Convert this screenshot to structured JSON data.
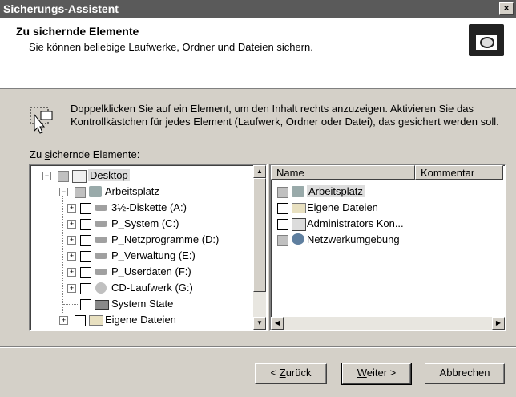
{
  "window": {
    "title": "Sicherungs-Assistent",
    "close_label": "×"
  },
  "header": {
    "title": "Zu sichernde Elemente",
    "subtitle": "Sie können beliebige Laufwerke, Ordner und Dateien sichern."
  },
  "info": {
    "text": "Doppelklicken Sie auf ein Element, um den Inhalt rechts anzuzeigen. Aktivieren Sie das Kontrollkästchen für jedes Element (Laufwerk, Ordner oder Datei), das gesichert werden soll."
  },
  "tree": {
    "label_pre": "Zu ",
    "label_key": "s",
    "label_post": "ichernde Elemente:",
    "items": [
      {
        "label": "Desktop",
        "icon": "desktop-icon"
      },
      {
        "label": "Arbeitsplatz",
        "icon": "computer-icon"
      },
      {
        "label": "3½-Diskette (A:)",
        "icon": "floppy-drive-icon"
      },
      {
        "label": "P_System (C:)",
        "icon": "drive-icon"
      },
      {
        "label": "P_Netzprogramme (D:)",
        "icon": "drive-icon"
      },
      {
        "label": "P_Verwaltung (E:)",
        "icon": "drive-icon"
      },
      {
        "label": "P_Userdaten (F:)",
        "icon": "drive-icon"
      },
      {
        "label": "CD-Laufwerk (G:)",
        "icon": "cd-drive-icon"
      },
      {
        "label": "System State",
        "icon": "system-state-icon"
      },
      {
        "label": "Eigene Dateien",
        "icon": "folder-icon"
      }
    ]
  },
  "list": {
    "columns": [
      "Name",
      "Kommentar"
    ],
    "rows": [
      {
        "name": "Arbeitsplatz",
        "icon": "computer-icon"
      },
      {
        "name": "Eigene Dateien",
        "icon": "folder-icon"
      },
      {
        "name": "Administrators Kon...",
        "icon": "admin-icon"
      },
      {
        "name": "Netzwerkumgebung",
        "icon": "network-icon"
      }
    ]
  },
  "buttons": {
    "back_pre": "< ",
    "back_key": "Z",
    "back_post": "urück",
    "next_key": "W",
    "next_post": "eiter >",
    "cancel": "Abbrechen"
  }
}
